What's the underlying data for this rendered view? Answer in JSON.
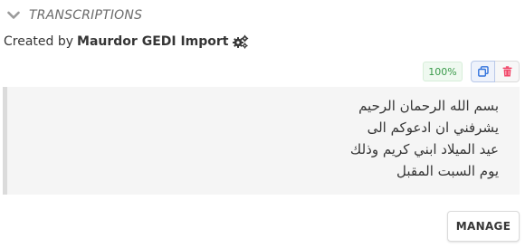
{
  "section": {
    "title": "TRANSCRIPTIONS",
    "toggle_icon": "chevron-down-icon"
  },
  "creator": {
    "prefix": "Created by",
    "source": "Maurdor GEDI Import",
    "source_icon": "gears-icon"
  },
  "transcription": {
    "confidence": "100%",
    "lines": [
      "بسم الله الرحمان الرحيم",
      "يشرفني ان ادعوكم الى",
      "عيد الميلاد ابني كريم وذلك",
      "يوم السبت المقبل"
    ],
    "actions": {
      "copy_icon": "copy-icon",
      "delete_icon": "trash-icon"
    }
  },
  "footer": {
    "manage_label": "MANAGE"
  },
  "colors": {
    "confidence_text": "#3a9a4a",
    "confidence_bg": "#eff9f0",
    "delete_icon": "#f14668",
    "copy_icon": "#3273dc",
    "box_bg": "#f5f5f5",
    "box_border": "#dbdbdb"
  }
}
